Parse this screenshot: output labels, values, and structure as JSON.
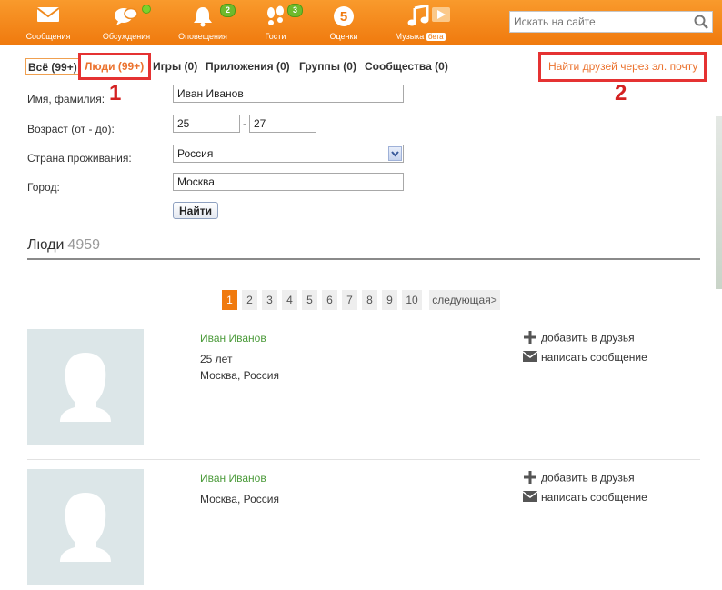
{
  "topnav": {
    "items": [
      {
        "label": "Сообщения",
        "icon": "envelope-icon"
      },
      {
        "label": "Обсуждения",
        "icon": "chat-bubbles-icon"
      },
      {
        "label": "Оповещения",
        "icon": "bell-icon",
        "badge": "2"
      },
      {
        "label": "Гости",
        "icon": "footprints-icon",
        "badge": "3"
      },
      {
        "label": "Оценки",
        "icon": "rating-five-icon",
        "glyph": "5"
      },
      {
        "label": "Музыка",
        "icon": "music-note-icon",
        "tag": "бета"
      }
    ],
    "search_placeholder": "Искать на сайте"
  },
  "tabs": [
    {
      "label": "Всё (99+)"
    },
    {
      "label": "Люди (99+)",
      "active": true
    },
    {
      "label": "Игры (0)"
    },
    {
      "label": "Приложения (0)"
    },
    {
      "label": "Группы (0)"
    },
    {
      "label": "Сообщества (0)"
    }
  ],
  "find_by_email_link": "Найти друзей через эл. почту",
  "annotations": {
    "one": "1",
    "two": "2"
  },
  "form": {
    "name_label": "Имя, фамилия:",
    "name_value": "Иван Иванов",
    "age_label": "Возраст (от - до):",
    "age_from": "25",
    "age_dash": "-",
    "age_to": "27",
    "country_label": "Страна проживания:",
    "country_value": "Россия",
    "city_label": "Город:",
    "city_value": "Москва",
    "submit_label": "Найти"
  },
  "results": {
    "title": "Люди",
    "count": "4959"
  },
  "pagination": {
    "pages": [
      "1",
      "2",
      "3",
      "4",
      "5",
      "6",
      "7",
      "8",
      "9",
      "10"
    ],
    "current": "1",
    "next_label": "следующая>"
  },
  "people": [
    {
      "name": "Иван Иванов",
      "age": "25 лет",
      "location": "Москва, Россия"
    },
    {
      "name": "Иван Иванов",
      "location": "Москва, Россия"
    }
  ],
  "actions": {
    "add_friend": "добавить в друзья",
    "write_message": "написать сообщение"
  },
  "colors": {
    "topbar": "#f07a0e",
    "accent": "#eb722e",
    "name_link": "#4c9b3b",
    "highlight": "#e53232",
    "badge": "#6fba2c"
  }
}
